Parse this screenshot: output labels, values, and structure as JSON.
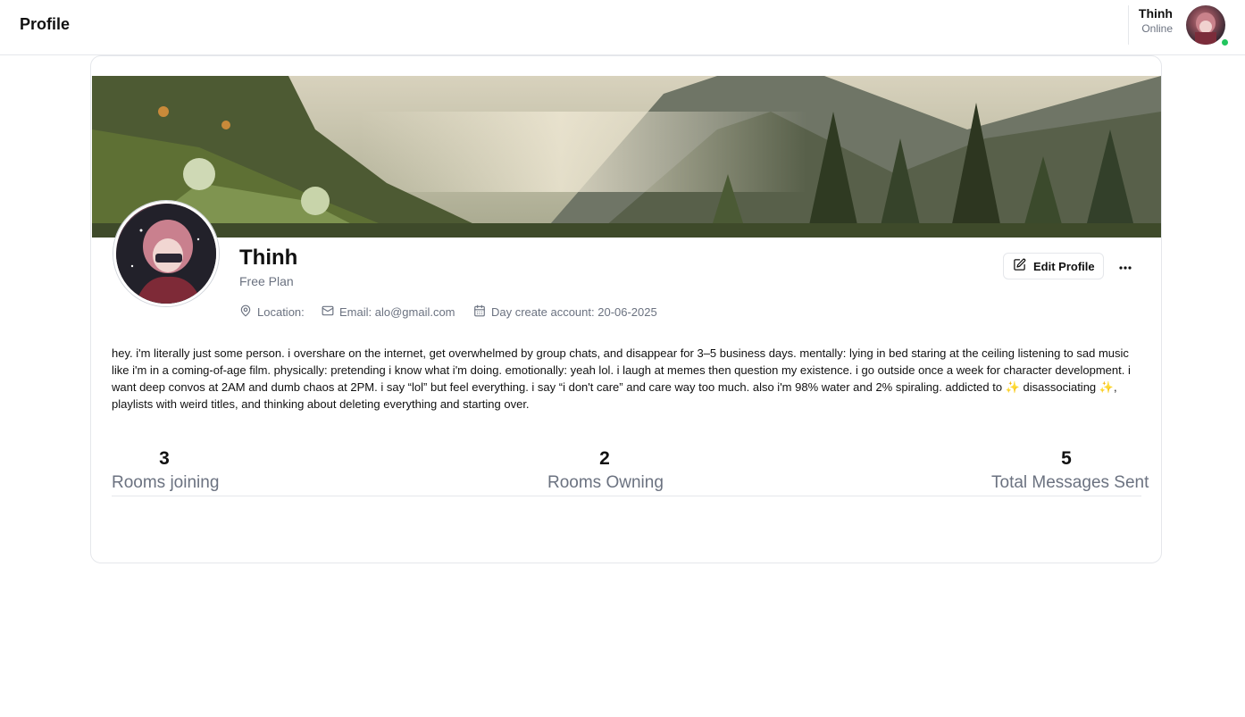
{
  "header": {
    "title": "Profile",
    "user": {
      "name": "Thinh",
      "status": "Online",
      "status_color": "#22c55e"
    }
  },
  "profile": {
    "name": "Thinh",
    "plan": "Free Plan",
    "edit_label": "Edit Profile",
    "location": "Location:",
    "email": "Email: alo@gmail.com",
    "created": "Day create account: 20-06-2025",
    "bio": "hey. i'm literally just some person. i overshare on the internet, get overwhelmed by group chats, and disappear for 3–5 business days. mentally: lying in bed staring at the ceiling listening to sad music like i'm in a coming-of-age film. physically: pretending i know what i'm doing. emotionally: yeah lol. i laugh at memes then question my existence. i go outside once a week for character development. i want deep convos at 2AM and dumb chaos at 2PM. i say “lol” but feel everything. i say “i don't care” and care way too much. also i'm 98% water and 2% spiraling. addicted to ✨ disassociating ✨, playlists with weird titles, and thinking about deleting everything and starting over."
  },
  "stats": [
    {
      "value": "3",
      "label": "Rooms joining"
    },
    {
      "value": "2",
      "label": "Rooms Owning"
    },
    {
      "value": "5",
      "label": "Total Messages Sent"
    }
  ],
  "icons": [
    "edit-icon",
    "more-icon",
    "location-icon",
    "mail-icon",
    "calendar-icon"
  ]
}
